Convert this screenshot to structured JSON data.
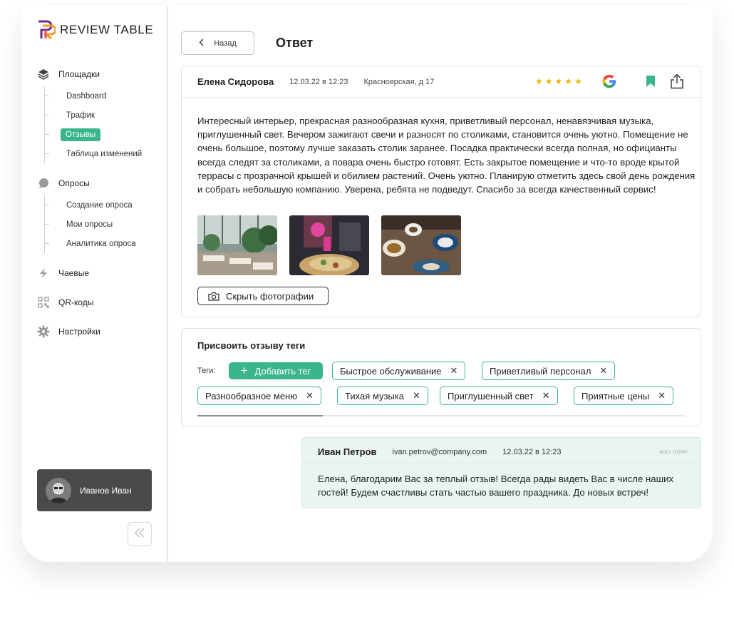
{
  "brand": {
    "name": "REVIEW TABLE",
    "colors": {
      "accent": "#3bb58c",
      "logo_orange": "#f59b23",
      "logo_purple": "#6a2c8f",
      "star": "#f0b400"
    }
  },
  "sidebar": {
    "groups": [
      {
        "label": "Площадки",
        "icon": "layers-icon",
        "items": [
          "Dashboard",
          "Трафик",
          "Отзывы",
          "Таблица изменений"
        ],
        "active": "Отзывы"
      },
      {
        "label": "Опросы",
        "icon": "chat-bubble-icon",
        "items": [
          "Создание опроса",
          "Мои опросы",
          "Аналитика опроса"
        ]
      },
      {
        "label": "Чаевые",
        "icon": "lightning-icon",
        "items": []
      },
      {
        "label": "QR-коды",
        "icon": "qr-code-icon",
        "items": []
      },
      {
        "label": "Настройки",
        "icon": "gear-icon",
        "items": []
      }
    ],
    "user": {
      "name": "Иванов Иван"
    }
  },
  "header": {
    "back_label": "Назад",
    "title": "Ответ"
  },
  "review": {
    "author": "Елена Сидорова",
    "date": "12.03.22 в 12:23",
    "place": "Красноярская, д 17",
    "rating": 5,
    "source_icon": "google-icon",
    "text": "Интересный интерьер, прекрасная разнообразная кухня, приветливый персонал, ненавязчивая музыка, приглушенный свет. Вечером зажигают свечи и разносят по столиками, становится очень уютно. Помещение не очень большое, поэтому лучше заказать столик заранее. Посадка практически всегда полная, но официанты всегда следят за столиками, а повара очень быстро готовят. Есть закрытое помещение и что-то вроде крытой террасы с прозрачной крышей и обилием растений. Очень уютно. Планирую отметить здесь свой день рождения и собрать небольшую компанию. Уверена, ребята не подведут. Спасибо за всегда качественный сервис!",
    "hide_photos_label": "Скрыть фотографии"
  },
  "tags": {
    "title": "Присвоить отзыву теги",
    "label": "Теги:",
    "add_label": "Добавить тег",
    "items": [
      "Быстрое обслуживание",
      "Приветливый персонал",
      "Разнообразное меню",
      "Тихая музыка",
      "Приглушенный свет",
      "Приятные цены"
    ]
  },
  "reply": {
    "author": "Иван Петров",
    "email": "ivan.petrov@company.com",
    "date": "12.03.22 в 12:23",
    "badge": "ваш ответ",
    "text": "Елена, благодарим Вас за теплый отзыв! Всегда рады видеть Вас в числе наших гостей! Будем счастливы стать частью вашего праздника. До новых встреч!"
  }
}
